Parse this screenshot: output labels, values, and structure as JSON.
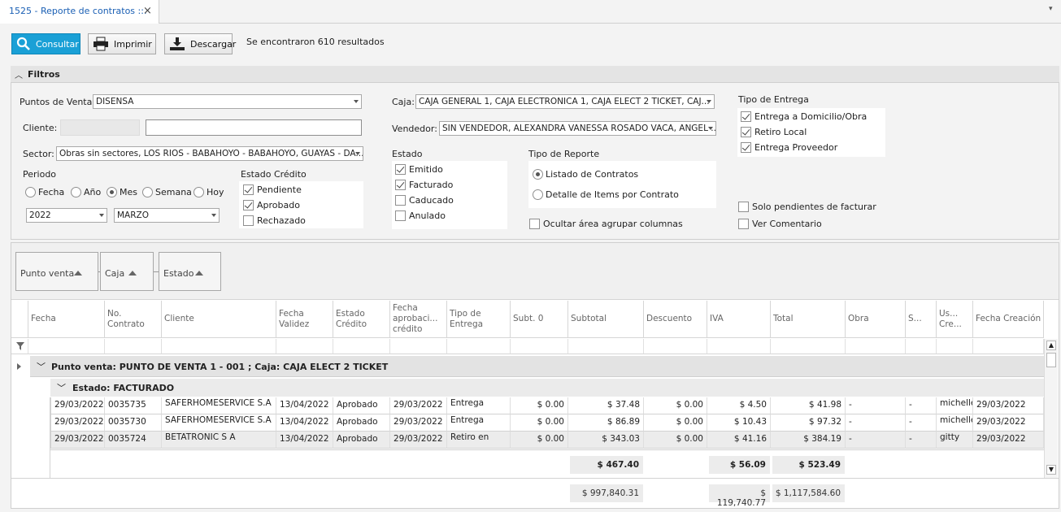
{
  "tab": {
    "title": "1525 - Reporte de contratos ::.",
    "close": "×",
    "menu": "▾"
  },
  "toolbar": {
    "consultar": "Consultar",
    "imprimir": "Imprimir",
    "descargar": "Descargar",
    "result_text": "Se encontraron 610 resultados"
  },
  "filters": {
    "title": "Filtros",
    "puntos_venta_label": "Puntos de Venta:",
    "puntos_venta_value": "DISENSA",
    "cliente_label": "Cliente:",
    "cliente_value": "",
    "sector_label": "Sector:",
    "sector_value": "Obras sin sectores, LOS RIOS - BABAHOYO - BABAHOYO, GUAYAS - DA...",
    "caja_label": "Caja:",
    "caja_value": "CAJA GENERAL 1, CAJA ELECTRONICA 1, CAJA ELECT 2 TICKET, CAJ...",
    "vendedor_label": "Vendedor:",
    "vendedor_value": "SIN VENDEDOR, ALEXANDRA VANESSA ROSADO VACA, ANGEL ...",
    "periodo_label": "Periodo",
    "periodo_options": [
      "Fecha",
      "Año",
      "Mes",
      "Semana",
      "Hoy"
    ],
    "periodo_selected": "Mes",
    "year_value": "2022",
    "month_value": "MARZO",
    "estado_credito_label": "Estado Crédito",
    "estado_credito": [
      {
        "label": "Pendiente",
        "checked": true
      },
      {
        "label": "Aprobado",
        "checked": true
      },
      {
        "label": "Rechazado",
        "checked": false
      }
    ],
    "estado_label": "Estado",
    "estado": [
      {
        "label": "Emitido",
        "checked": true
      },
      {
        "label": "Facturado",
        "checked": true
      },
      {
        "label": "Caducado",
        "checked": false
      },
      {
        "label": "Anulado",
        "checked": false
      }
    ],
    "tipo_reporte_label": "Tipo de Reporte",
    "tipo_reporte": [
      {
        "label": "Listado de Contratos",
        "selected": true
      },
      {
        "label": "Detalle de Items por Contrato",
        "selected": false
      }
    ],
    "ocultar_label": "Ocultar área agrupar columnas",
    "tipo_entrega_label": "Tipo de Entrega",
    "tipo_entrega": [
      {
        "label": "Entrega a Domicilio/Obra",
        "checked": true
      },
      {
        "label": "Retiro Local",
        "checked": true
      },
      {
        "label": "Entrega Proveedor",
        "checked": true
      }
    ],
    "solo_pendientes_label": "Solo pendientes de facturar",
    "ver_comentario_label": "Ver Comentario"
  },
  "grid": {
    "group_chips": [
      "Punto venta",
      "Caja",
      "Estado"
    ],
    "columns": [
      "Fecha",
      "No. Contrato",
      "Cliente",
      "Fecha Validez",
      "Estado Crédito",
      "Fecha aprobaci... crédito",
      "Tipo de Entrega",
      "Subt. 0",
      "Subtotal",
      "Descuento",
      "IVA",
      "Total",
      "Obra",
      "S...",
      "Us... Cre...",
      "Fecha Creación"
    ],
    "group1": "Punto venta: PUNTO DE VENTA 1 - 001 ; Caja: CAJA ELECT 2 TICKET",
    "group2": "Estado: FACTURADO",
    "rows": [
      [
        "29/03/2022",
        "0035735",
        "SAFERHOMESERVICE S.A",
        "13/04/2022",
        "Aprobado",
        "29/03/2022",
        "Entrega",
        "$ 0.00",
        "$ 37.48",
        "$ 0.00",
        "$ 4.50",
        "$ 41.98",
        "-",
        "-",
        "michelle",
        "29/03/2022"
      ],
      [
        "29/03/2022",
        "0035730",
        "SAFERHOMESERVICE S.A",
        "13/04/2022",
        "Aprobado",
        "29/03/2022",
        "Entrega",
        "$ 0.00",
        "$ 86.89",
        "$ 0.00",
        "$ 10.43",
        "$ 97.32",
        "-",
        "-",
        "michelle",
        "29/03/2022"
      ],
      [
        "29/03/2022",
        "0035724",
        "BETATRONIC S A",
        "13/04/2022",
        "Aprobado",
        "29/03/2022",
        "Retiro en",
        "$ 0.00",
        "$ 343.03",
        "$ 0.00",
        "$ 41.16",
        "$ 384.19",
        "-",
        "-",
        "gitty",
        "29/03/2022"
      ]
    ],
    "group_summary": {
      "subtotal": "$ 467.40",
      "iva": "$ 56.09",
      "total": "$ 523.49"
    },
    "grand_total": {
      "subtotal": "$ 997,840.31",
      "iva": "$ 119,740.77",
      "total": "$ 1,117,584.60"
    }
  }
}
